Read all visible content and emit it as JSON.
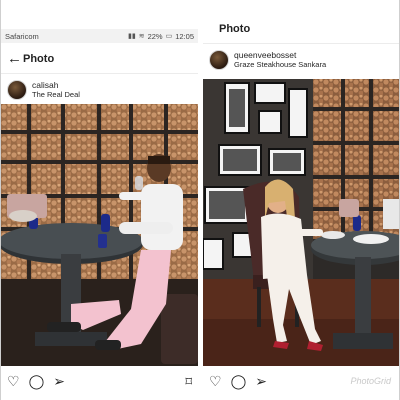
{
  "left_panel": {
    "status_bar": {
      "carrier": "Safaricom",
      "battery": "22%",
      "time": "12:05"
    },
    "header": {
      "back_icon": "back-arrow-icon",
      "title": "Photo"
    },
    "post": {
      "username": "calisah",
      "location": "The Real Deal"
    },
    "actions": [
      "heart-icon",
      "comment-icon",
      "share-icon",
      "bookmark-icon"
    ]
  },
  "right_panel": {
    "header": {
      "title": "Photo"
    },
    "post": {
      "username": "queenveebosset",
      "location": "Graze Steakhouse Sankara"
    },
    "actions": [
      "heart-icon",
      "comment-icon",
      "share-icon"
    ],
    "watermark": "PhotoGrid"
  }
}
